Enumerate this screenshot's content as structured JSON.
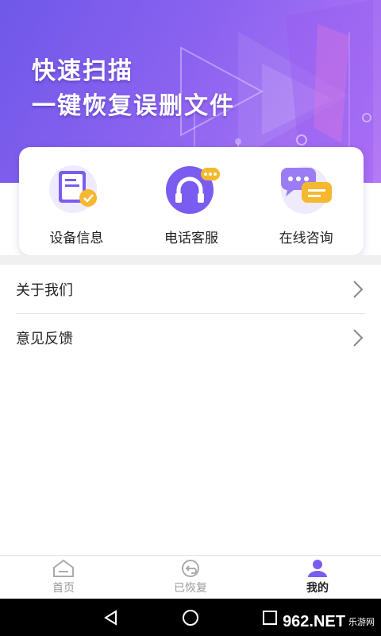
{
  "banner": {
    "title": "快速扫描",
    "subtitle": "一键恢复误删文件"
  },
  "services": [
    {
      "label": "设备信息",
      "icon": "device-info-icon"
    },
    {
      "label": "电话客服",
      "icon": "headset-icon"
    },
    {
      "label": "在线咨询",
      "icon": "chat-bubbles-icon"
    }
  ],
  "menu": [
    {
      "label": "关于我们"
    },
    {
      "label": "意见反馈"
    }
  ],
  "tabs": [
    {
      "label": "首页",
      "icon": "home-icon",
      "active": false
    },
    {
      "label": "已恢复",
      "icon": "restore-icon",
      "active": false
    },
    {
      "label": "我的",
      "icon": "profile-icon",
      "active": true
    }
  ],
  "watermark": {
    "main": "962.NET",
    "sub": "乐游网"
  },
  "colors": {
    "brand": "#7b5cf0",
    "accent": "#f5b82e",
    "bg_gap": "#f0f0f0"
  }
}
